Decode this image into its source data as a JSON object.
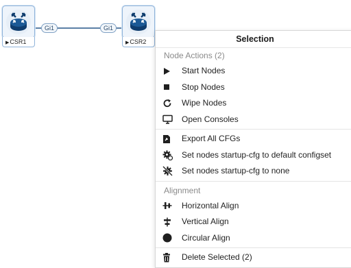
{
  "nodes": [
    {
      "label": "CSR1"
    },
    {
      "label": "CSR2"
    }
  ],
  "link": {
    "iface_a": "Gi1",
    "iface_b": "Gi1"
  },
  "menu": {
    "title": "Selection",
    "node_actions_header": "Node Actions (2)",
    "node_actions": [
      {
        "label": "Start Nodes",
        "icon": "play-icon"
      },
      {
        "label": "Stop Nodes",
        "icon": "stop-icon"
      },
      {
        "label": "Wipe Nodes",
        "icon": "refresh-icon"
      },
      {
        "label": "Open Consoles",
        "icon": "monitor-icon"
      }
    ],
    "config_actions": [
      {
        "label": "Export All CFGs",
        "icon": "file-export-icon"
      },
      {
        "label": "Set nodes startup-cfg to default configset",
        "icon": "gear-config-icon"
      },
      {
        "label": "Set nodes startup-cfg to none",
        "icon": "gear-off-icon"
      }
    ],
    "alignment_header": "Alignment",
    "alignment_actions": [
      {
        "label": "Horizontal Align",
        "icon": "horizontal-align-icon"
      },
      {
        "label": "Vertical Align",
        "icon": "vertical-align-icon"
      },
      {
        "label": "Circular Align",
        "icon": "circle-icon"
      }
    ],
    "delete_label": "Delete Selected (2)",
    "delete_icon": "trash-icon"
  },
  "colors": {
    "node_border": "#8fb3d9",
    "link": "#5a7fa6",
    "router": "#0f3d6e"
  }
}
